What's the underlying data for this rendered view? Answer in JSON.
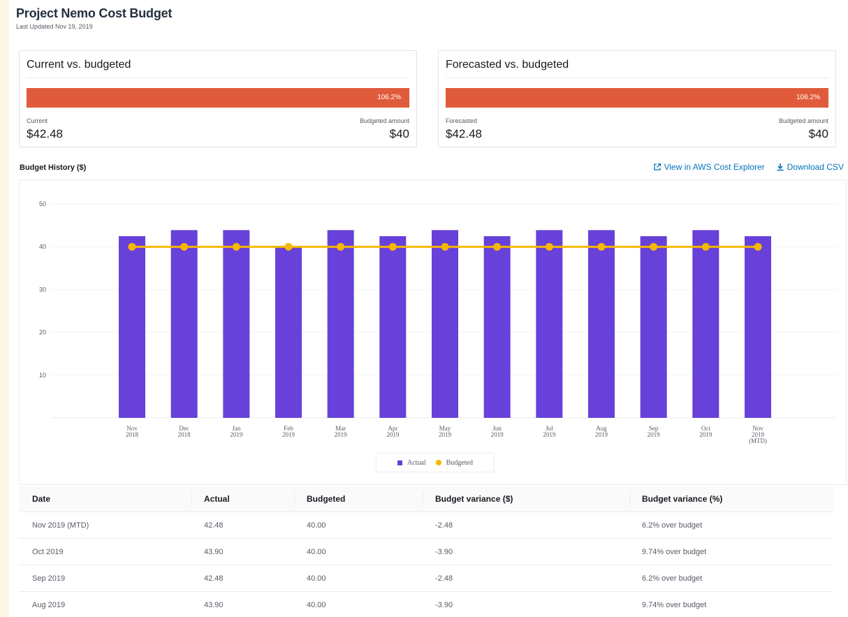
{
  "header": {
    "title": "Project Nemo Cost Budget",
    "subtitle": "Last Updated Nov 19, 2019"
  },
  "cards": [
    {
      "title": "Current vs. budgeted",
      "percent_label": "106.2%",
      "percent": 106.2,
      "left_label": "Current",
      "left_value": "$42.48",
      "right_label": "Budgeted amount",
      "right_value": "$40"
    },
    {
      "title": "Forecasted vs. budgeted",
      "percent_label": "106.2%",
      "percent": 106.2,
      "left_label": "Forecasted",
      "left_value": "$42.48",
      "right_label": "Budgeted amount",
      "right_value": "$40"
    }
  ],
  "history": {
    "title": "Budget History ($)",
    "view_link": "View in AWS Cost Explorer",
    "download_link": "Download CSV"
  },
  "colors": {
    "actual": "#6741d9",
    "budgeted": "#f5b800",
    "bar_alert": "#e05b3c",
    "link": "#0073bb"
  },
  "chart_data": {
    "type": "bar",
    "categories": [
      [
        "Nov",
        "2018"
      ],
      [
        "Dec",
        "2018"
      ],
      [
        "Jan",
        "2019"
      ],
      [
        "Feb",
        "2019"
      ],
      [
        "Mar",
        "2019"
      ],
      [
        "Apr",
        "2019"
      ],
      [
        "May",
        "2019"
      ],
      [
        "Jun",
        "2019"
      ],
      [
        "Jul",
        "2019"
      ],
      [
        "Aug",
        "2019"
      ],
      [
        "Sep",
        "2019"
      ],
      [
        "Oct",
        "2019"
      ],
      [
        "Nov",
        "2019",
        "(MTD)"
      ]
    ],
    "series": [
      {
        "name": "Actual",
        "type": "bar",
        "values": [
          42.48,
          43.9,
          43.9,
          40.0,
          43.9,
          42.48,
          43.9,
          42.48,
          43.9,
          43.9,
          42.48,
          43.9,
          42.48
        ]
      },
      {
        "name": "Budgeted",
        "type": "line",
        "values": [
          40,
          40,
          40,
          40,
          40,
          40,
          40,
          40,
          40,
          40,
          40,
          40,
          40
        ]
      }
    ],
    "ylim": [
      0,
      50
    ],
    "yticks": [
      10,
      20,
      30,
      40,
      50
    ],
    "grid": true,
    "legend_position": "bottom-center"
  },
  "table": {
    "columns": [
      "Date",
      "Actual",
      "Budgeted",
      "Budget variance ($)",
      "Budget variance (%)"
    ],
    "rows": [
      [
        "Nov 2019 (MTD)",
        "42.48",
        "40.00",
        "-2.48",
        "6.2% over budget"
      ],
      [
        "Oct 2019",
        "43.90",
        "40.00",
        "-3.90",
        "9.74% over budget"
      ],
      [
        "Sep 2019",
        "42.48",
        "40.00",
        "-2.48",
        "6.2% over budget"
      ],
      [
        "Aug 2019",
        "43.90",
        "40.00",
        "-3.90",
        "9.74% over budget"
      ]
    ]
  }
}
